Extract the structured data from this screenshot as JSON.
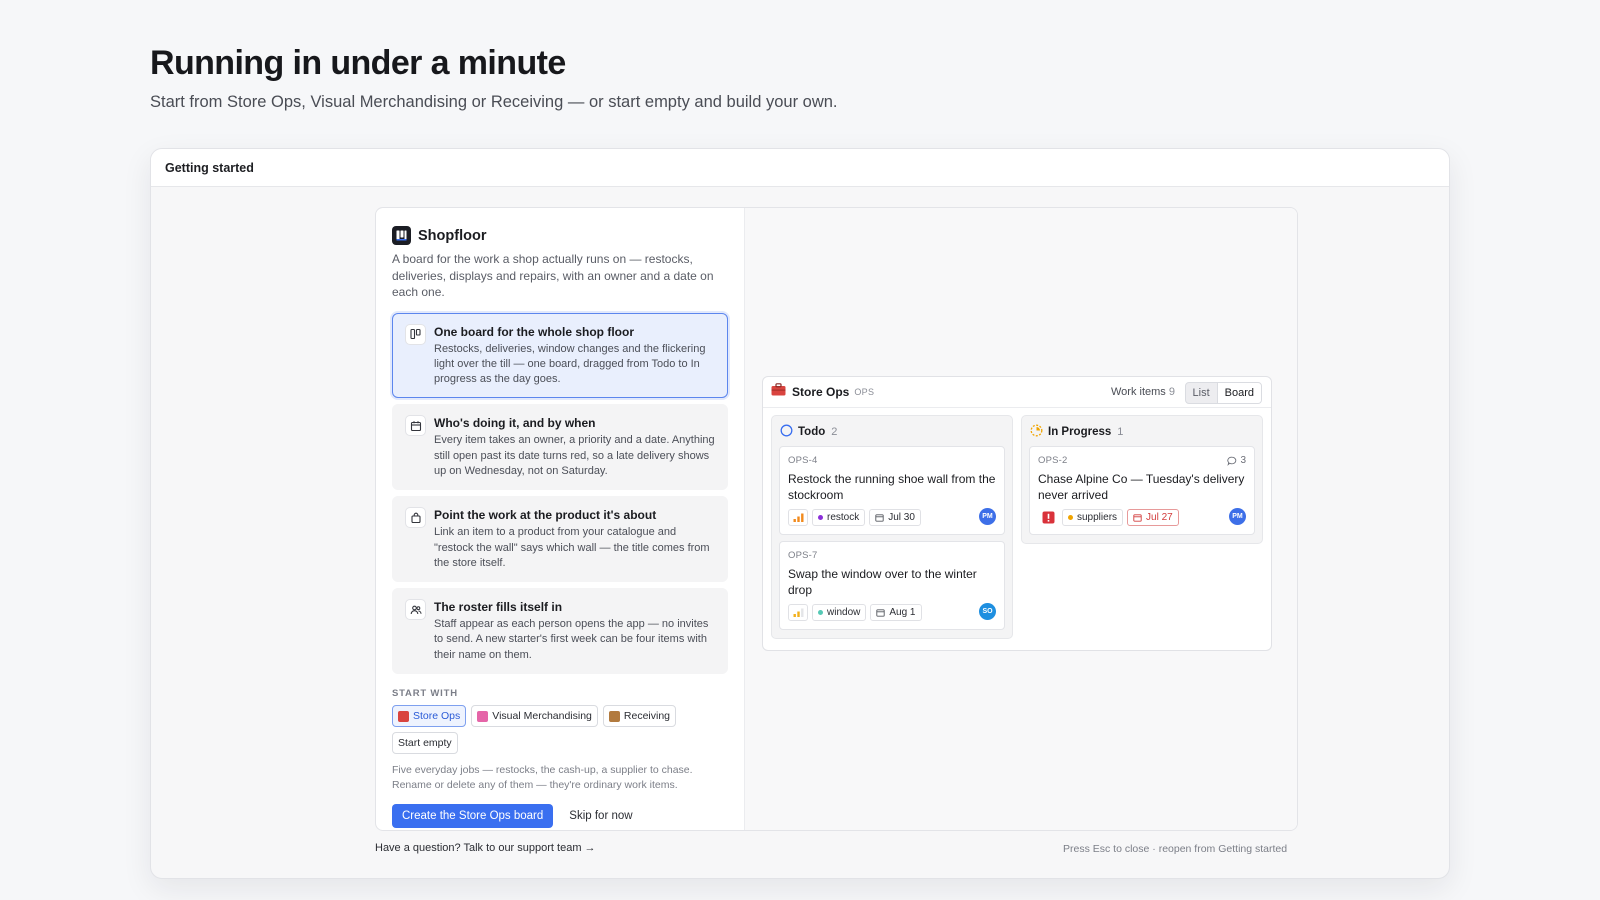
{
  "hero": {
    "title": "Running in under a minute",
    "subtitle": "Start from Store Ops, Visual Merchandising or Receiving — or start empty and build your own."
  },
  "frame": {
    "title": "Getting started"
  },
  "brand": {
    "name": "Shopfloor",
    "description": "A board for the work a shop actually runs on — restocks, deliveries, displays and repairs, with an owner and a date on each one."
  },
  "features": [
    {
      "icon": "board-icon",
      "title": "One board for the whole shop floor",
      "body": "Restocks, deliveries, window changes and the flickering light over the till — one board, dragged from Todo to In progress as the day goes.",
      "active": true
    },
    {
      "icon": "calendar-icon",
      "title": "Who's doing it, and by when",
      "body": "Every item takes an owner, a priority and a date. Anything still open past its date turns red, so a late delivery shows up on Wednesday, not on Saturday.",
      "active": false
    },
    {
      "icon": "bag-icon",
      "title": "Point the work at the product it's about",
      "body": "Link an item to a product from your catalogue and \"restock the wall\" says which wall — the title comes from the store itself.",
      "active": false
    },
    {
      "icon": "people-icon",
      "title": "The roster fills itself in",
      "body": "Staff appear as each person opens the app — no invites to send. A new starter's first week can be four items with their name on them.",
      "active": false
    }
  ],
  "start": {
    "label": "START WITH",
    "options": [
      {
        "label": "Store Ops",
        "icon": "toolbox-icon",
        "color": "#d9443f",
        "selected": true
      },
      {
        "label": "Visual Merchandising",
        "icon": "shopping-bags-icon",
        "color": "#e565a8",
        "selected": false
      },
      {
        "label": "Receiving",
        "icon": "package-icon",
        "color": "#b27a3e",
        "selected": false
      },
      {
        "label": "Start empty",
        "icon": "",
        "color": "",
        "selected": false
      }
    ],
    "hint": "Five everyday jobs — restocks, the cash-up, a supplier to chase. Rename or delete any of them — they're ordinary work items.",
    "primary": "Create the Store Ops board",
    "secondary": "Skip for now"
  },
  "board": {
    "title": "Store Ops",
    "key": "OPS",
    "count_label": "Work items",
    "count": "9",
    "views": [
      "List",
      "Board"
    ],
    "active_view": "Board",
    "columns": [
      {
        "name": "Todo",
        "count": "2",
        "status": "todo",
        "cards": [
          {
            "id": "OPS-4",
            "title": "Restock the running shoe wall from the stockroom",
            "priority": "high",
            "label": "restock",
            "label_color": "#8b2fd9",
            "due": "Jul 30",
            "overdue": false,
            "assignee": "PM",
            "assignee_color": "#3d6fe8",
            "comments": ""
          },
          {
            "id": "OPS-7",
            "title": "Swap the window over to the winter drop",
            "priority": "medium",
            "label": "window",
            "label_color": "#55c9b5",
            "due": "Aug 1",
            "overdue": false,
            "assignee": "SO",
            "assignee_color": "#1e8fe0",
            "comments": ""
          }
        ]
      },
      {
        "name": "In Progress",
        "count": "1",
        "status": "in-progress",
        "cards": [
          {
            "id": "OPS-2",
            "title": "Chase Alpine Co — Tuesday's delivery never arrived",
            "priority": "urgent",
            "label": "suppliers",
            "label_color": "#f0a400",
            "due": "Jul 27",
            "overdue": true,
            "assignee": "PM",
            "assignee_color": "#3d6fe8",
            "comments": "3"
          }
        ]
      }
    ]
  },
  "footer": {
    "support": "Have a question? Talk to our support team →",
    "esc": "Press Esc to close · reopen from Getting started"
  }
}
